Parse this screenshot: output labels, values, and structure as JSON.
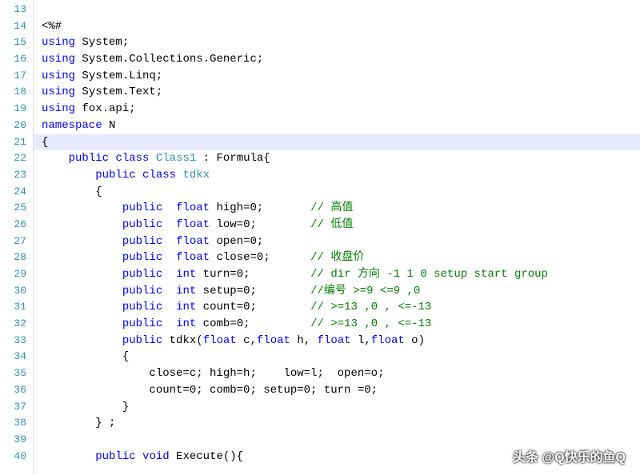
{
  "gutter": {
    "start": 13,
    "end": 40
  },
  "highlight_line": 21,
  "lines": {
    "l13": [
      {
        "c": "txt",
        "t": ""
      }
    ],
    "l14": [
      {
        "c": "txt",
        "t": "<%#"
      }
    ],
    "l15": [
      {
        "c": "kw",
        "t": "using"
      },
      {
        "c": "txt",
        "t": " System;"
      }
    ],
    "l16": [
      {
        "c": "kw",
        "t": "using"
      },
      {
        "c": "txt",
        "t": " System.Collections.Generic;"
      }
    ],
    "l17": [
      {
        "c": "kw",
        "t": "using"
      },
      {
        "c": "txt",
        "t": " System.Linq;"
      }
    ],
    "l18": [
      {
        "c": "kw",
        "t": "using"
      },
      {
        "c": "txt",
        "t": " System.Text;"
      }
    ],
    "l19": [
      {
        "c": "kw",
        "t": "using"
      },
      {
        "c": "txt",
        "t": " fox.api;"
      }
    ],
    "l20": [
      {
        "c": "kw",
        "t": "namespace"
      },
      {
        "c": "txt",
        "t": " N"
      }
    ],
    "l21": [
      {
        "c": "txt",
        "t": "{"
      }
    ],
    "l22": [
      {
        "c": "txt",
        "t": "    "
      },
      {
        "c": "kw",
        "t": "public"
      },
      {
        "c": "txt",
        "t": " "
      },
      {
        "c": "kw",
        "t": "class"
      },
      {
        "c": "txt",
        "t": " "
      },
      {
        "c": "cls",
        "t": "Class1"
      },
      {
        "c": "txt",
        "t": " : Formula{"
      }
    ],
    "l23": [
      {
        "c": "txt",
        "t": "        "
      },
      {
        "c": "kw",
        "t": "public"
      },
      {
        "c": "txt",
        "t": " "
      },
      {
        "c": "kw",
        "t": "class"
      },
      {
        "c": "txt",
        "t": " "
      },
      {
        "c": "cls",
        "t": "tdkx"
      }
    ],
    "l24": [
      {
        "c": "txt",
        "t": "        {"
      }
    ],
    "l25": [
      {
        "c": "txt",
        "t": "            "
      },
      {
        "c": "kw",
        "t": "public"
      },
      {
        "c": "txt",
        "t": "  "
      },
      {
        "c": "kw",
        "t": "float"
      },
      {
        "c": "txt",
        "t": " high=0;       "
      },
      {
        "c": "com",
        "t": "// 高值"
      }
    ],
    "l26": [
      {
        "c": "txt",
        "t": "            "
      },
      {
        "c": "kw",
        "t": "public"
      },
      {
        "c": "txt",
        "t": "  "
      },
      {
        "c": "kw",
        "t": "float"
      },
      {
        "c": "txt",
        "t": " low=0;        "
      },
      {
        "c": "com",
        "t": "// 低值"
      }
    ],
    "l27": [
      {
        "c": "txt",
        "t": "            "
      },
      {
        "c": "kw",
        "t": "public"
      },
      {
        "c": "txt",
        "t": "  "
      },
      {
        "c": "kw",
        "t": "float"
      },
      {
        "c": "txt",
        "t": " open=0;"
      }
    ],
    "l28": [
      {
        "c": "txt",
        "t": "            "
      },
      {
        "c": "kw",
        "t": "public"
      },
      {
        "c": "txt",
        "t": "  "
      },
      {
        "c": "kw",
        "t": "float"
      },
      {
        "c": "txt",
        "t": " close=0;      "
      },
      {
        "c": "com",
        "t": "// 收盘价"
      }
    ],
    "l29": [
      {
        "c": "txt",
        "t": "            "
      },
      {
        "c": "kw",
        "t": "public"
      },
      {
        "c": "txt",
        "t": "  "
      },
      {
        "c": "kw",
        "t": "int"
      },
      {
        "c": "txt",
        "t": " turn=0;         "
      },
      {
        "c": "com",
        "t": "// dir 方向 -1 1 0 setup start group"
      }
    ],
    "l30": [
      {
        "c": "txt",
        "t": "            "
      },
      {
        "c": "kw",
        "t": "public"
      },
      {
        "c": "txt",
        "t": "  "
      },
      {
        "c": "kw",
        "t": "int"
      },
      {
        "c": "txt",
        "t": " setup=0;        "
      },
      {
        "c": "com",
        "t": "//编号 >=9 <=9 ,0"
      }
    ],
    "l31": [
      {
        "c": "txt",
        "t": "            "
      },
      {
        "c": "kw",
        "t": "public"
      },
      {
        "c": "txt",
        "t": "  "
      },
      {
        "c": "kw",
        "t": "int"
      },
      {
        "c": "txt",
        "t": " count=0;        "
      },
      {
        "c": "com",
        "t": "// >=13 ,0 , <=-13"
      }
    ],
    "l32": [
      {
        "c": "txt",
        "t": "            "
      },
      {
        "c": "kw",
        "t": "public"
      },
      {
        "c": "txt",
        "t": "  "
      },
      {
        "c": "kw",
        "t": "int"
      },
      {
        "c": "txt",
        "t": " comb=0;         "
      },
      {
        "c": "com",
        "t": "// >=13 ,0 , <=-13"
      }
    ],
    "l33": [
      {
        "c": "txt",
        "t": "            "
      },
      {
        "c": "kw",
        "t": "public"
      },
      {
        "c": "txt",
        "t": " tdkx("
      },
      {
        "c": "kw",
        "t": "float"
      },
      {
        "c": "txt",
        "t": " c,"
      },
      {
        "c": "kw",
        "t": "float"
      },
      {
        "c": "txt",
        "t": " h, "
      },
      {
        "c": "kw",
        "t": "float"
      },
      {
        "c": "txt",
        "t": " l,"
      },
      {
        "c": "kw",
        "t": "float"
      },
      {
        "c": "txt",
        "t": " o)"
      }
    ],
    "l34": [
      {
        "c": "txt",
        "t": "            {"
      }
    ],
    "l35": [
      {
        "c": "txt",
        "t": "                close=c; high=h;    low=l;  open=o;"
      }
    ],
    "l36": [
      {
        "c": "txt",
        "t": "                count=0; comb=0; setup=0; turn =0;"
      }
    ],
    "l37": [
      {
        "c": "txt",
        "t": "            }"
      }
    ],
    "l38": [
      {
        "c": "txt",
        "t": "        } ;"
      }
    ],
    "l39": [
      {
        "c": "txt",
        "t": ""
      }
    ],
    "l40": [
      {
        "c": "txt",
        "t": "        "
      },
      {
        "c": "kw",
        "t": "public"
      },
      {
        "c": "txt",
        "t": " "
      },
      {
        "c": "kw",
        "t": "void"
      },
      {
        "c": "txt",
        "t": " Execute(){"
      }
    ]
  },
  "watermark": "头条 @Q快乐的鱼Q"
}
